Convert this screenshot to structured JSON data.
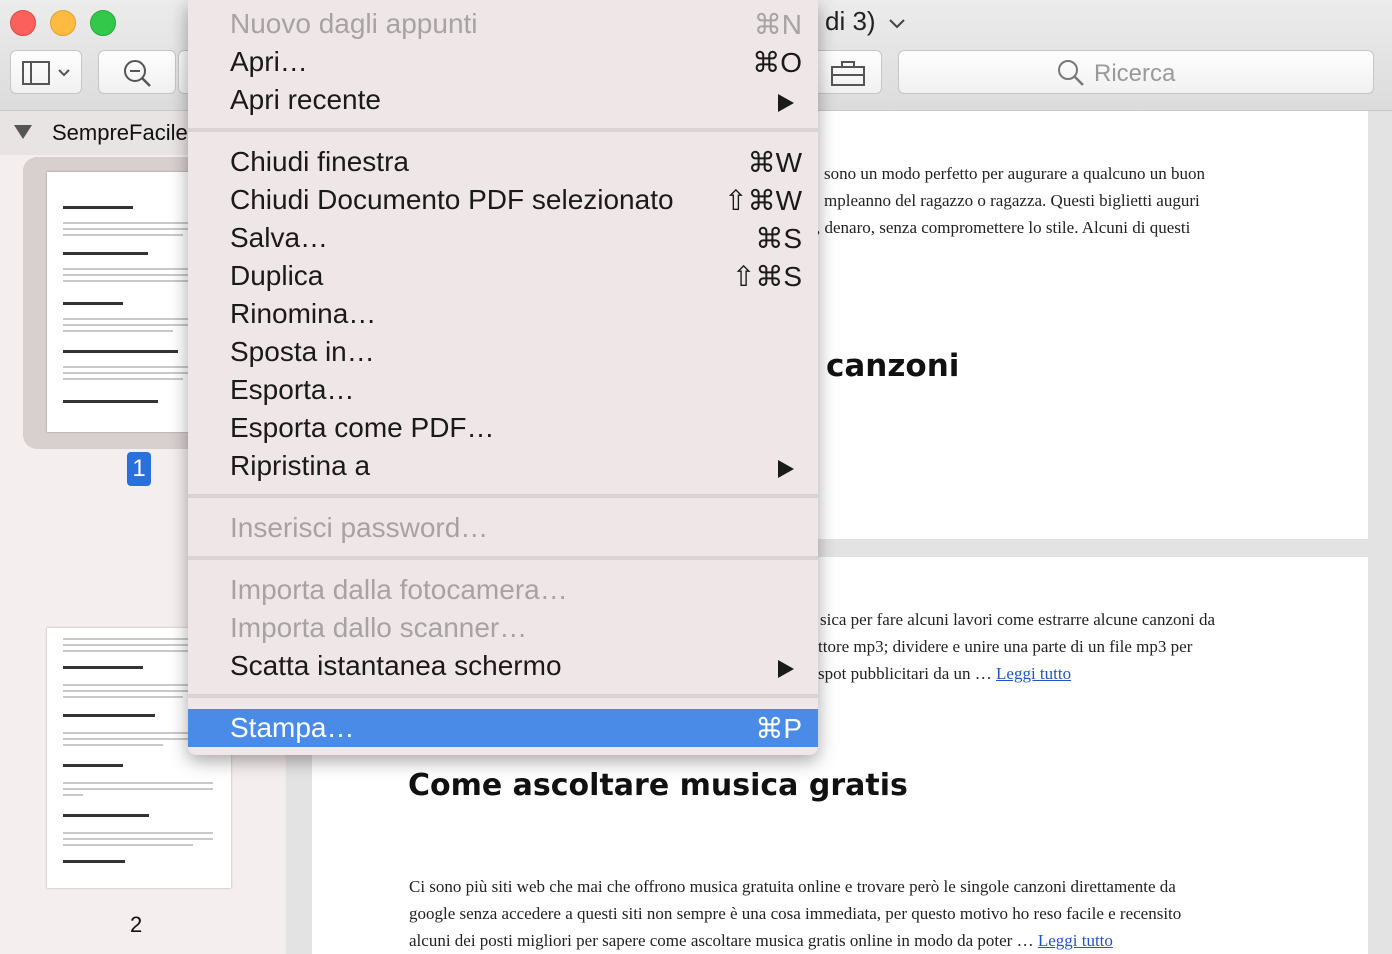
{
  "window": {
    "title_suffix": "di 3)"
  },
  "toolbar": {
    "search_placeholder": "Ricerca"
  },
  "sidebar": {
    "doc_title": "SempreFacile",
    "page_1": "1",
    "page_2": "2"
  },
  "document": {
    "p1_line1": "sono un modo perfetto per augurare a qualcuno un buon",
    "p1_line2": "mpleanno del ragazzo o ragazza. Questi biglietti auguri",
    "p1_line3": ", denaro, senza compromettere lo stile. Alcuni di questi",
    "heading1": "canzoni",
    "p2_line1": "sica per fare alcuni lavori come estrarre alcune canzoni da",
    "p2_line2": "ttore mp3; dividere e unire una parte di un file mp3 per",
    "p2_line3": "spot pubblicitari da un …",
    "read_more": "Leggi tutto",
    "heading2": "Come ascoltare musica gratis",
    "p3_line1": "Ci sono più siti web che mai che offrono musica gratuita online e trovare però le singole canzoni direttamente da",
    "p3_line2": "google senza accedere a questi siti non sempre è una cosa immediata, per questo motivo ho reso facile e recensito",
    "p3_line3": "alcuni dei posti migliori per sapere come ascoltare musica gratis online in modo da poter …"
  },
  "menu": {
    "items": [
      {
        "label": "Nuovo dagli appunti",
        "shortcut": "⌘N"
      },
      {
        "label": "Apri…",
        "shortcut": "⌘O"
      },
      {
        "label": "Apri recente",
        "shortcut": ""
      },
      {
        "label": "Chiudi finestra",
        "shortcut": "⌘W"
      },
      {
        "label": "Chiudi Documento PDF selezionato",
        "shortcut": "⇧⌘W"
      },
      {
        "label": "Salva…",
        "shortcut": "⌘S"
      },
      {
        "label": "Duplica",
        "shortcut": "⇧⌘S"
      },
      {
        "label": "Rinomina…",
        "shortcut": ""
      },
      {
        "label": "Sposta in…",
        "shortcut": ""
      },
      {
        "label": "Esporta…",
        "shortcut": ""
      },
      {
        "label": "Esporta come PDF…",
        "shortcut": ""
      },
      {
        "label": "Ripristina a",
        "shortcut": ""
      },
      {
        "label": "Inserisci password…",
        "shortcut": ""
      },
      {
        "label": "Importa dalla fotocamera…",
        "shortcut": ""
      },
      {
        "label": "Importa dallo scanner…",
        "shortcut": ""
      },
      {
        "label": "Scatta istantanea schermo",
        "shortcut": ""
      },
      {
        "label": "Stampa…",
        "shortcut": "⌘P"
      }
    ]
  },
  "colors": {
    "selection": "#4a8be8",
    "close": "#fc605c",
    "minimize": "#fdbc40",
    "zoom": "#34c84a"
  }
}
